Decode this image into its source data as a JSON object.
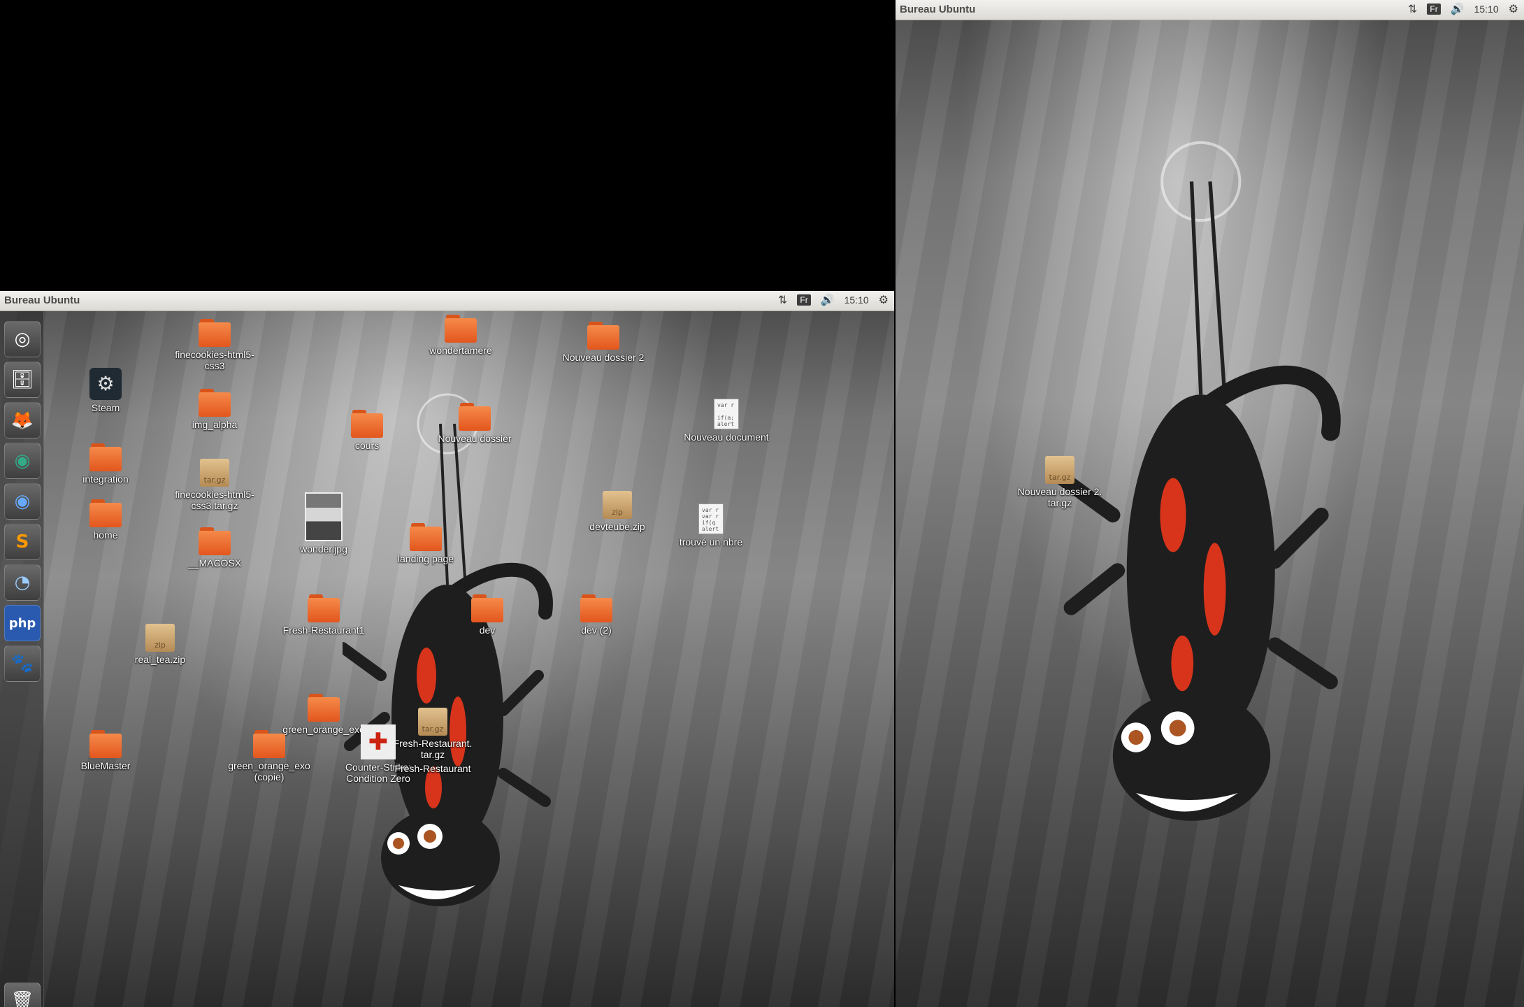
{
  "left_screen": {
    "panel": {
      "title": "Bureau Ubuntu",
      "keyboard": "Fr",
      "time": "15:10"
    },
    "launcher": [
      {
        "name": "ubuntu-dash",
        "glyph": "◎"
      },
      {
        "name": "files",
        "glyph": "🗄"
      },
      {
        "name": "firefox",
        "glyph": "🦊"
      },
      {
        "name": "chrome",
        "glyph": "◉"
      },
      {
        "name": "chromium",
        "glyph": "◉"
      },
      {
        "name": "sublime-text",
        "glyph": "S"
      },
      {
        "name": "app-swirl",
        "glyph": "◔"
      },
      {
        "name": "phpstorm",
        "glyph": "php"
      },
      {
        "name": "gimp",
        "glyph": "🐾"
      }
    ],
    "trash_glyph": "🗑",
    "icons": [
      {
        "label": "finecookies-html5-\ncss3",
        "type": "folder"
      },
      {
        "label": "wondertamere",
        "type": "folder"
      },
      {
        "label": "Nouveau dossier 2",
        "type": "folder"
      },
      {
        "label": "Steam",
        "type": "steam"
      },
      {
        "label": "img_alpha",
        "type": "folder"
      },
      {
        "label": "cours",
        "type": "folder"
      },
      {
        "label": "Nouveau dossier",
        "type": "folder"
      },
      {
        "label": "Nouveau document",
        "type": "doc",
        "preview": "var r\n\nif(a;\nalert"
      },
      {
        "label": "integration",
        "type": "folder"
      },
      {
        "label": "finecookies-html5-\ncss3.tar.gz",
        "type": "archive",
        "ext": "tar.gz"
      },
      {
        "label": "devteube.zip",
        "type": "archive",
        "ext": "zip"
      },
      {
        "label": "home",
        "type": "folder"
      },
      {
        "label": "wonder.jpg",
        "type": "image"
      },
      {
        "label": "trouvé un nbre",
        "type": "doc",
        "preview": "var r\nvar r\nif(q\nalert"
      },
      {
        "label": "__MACOSX",
        "type": "folder"
      },
      {
        "label": "landing page",
        "type": "folder"
      },
      {
        "label": "Fresh-Restaurant1",
        "type": "folder"
      },
      {
        "label": "dev",
        "type": "folder"
      },
      {
        "label": "dev (2)",
        "type": "folder"
      },
      {
        "label": "real_tea.zip",
        "type": "archive",
        "ext": "zip"
      },
      {
        "label": "green_orange_exo",
        "type": "folder"
      },
      {
        "label": "Fresh-Restaurant.\ntar.gz",
        "type": "archive",
        "ext": "tar.gz"
      },
      {
        "label": "BlueMaster",
        "type": "folder"
      },
      {
        "label": "green_orange_exo\n(copie)",
        "type": "folder"
      },
      {
        "label": "Counter-Strike:\nCondition Zero",
        "type": "cs"
      },
      {
        "label": "Fresh-Restaurant",
        "type": "folder"
      }
    ]
  },
  "right_screen": {
    "panel": {
      "title": "Bureau Ubuntu",
      "keyboard": "Fr",
      "time": "15:10"
    },
    "icons": [
      {
        "label": "Nouveau dossier 2.\ntar.gz",
        "type": "archive",
        "ext": "tar.gz"
      }
    ]
  },
  "colors": {
    "folder": "#e8642a",
    "panel": "#e6e4e0"
  }
}
